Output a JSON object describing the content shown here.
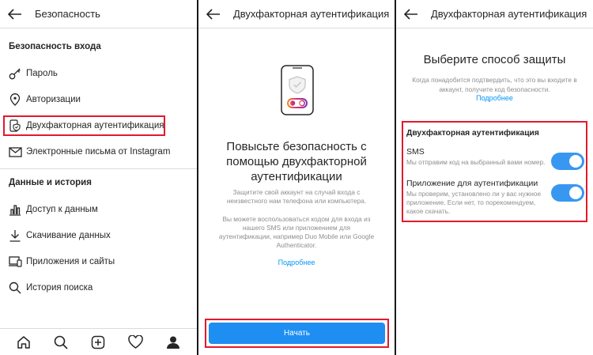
{
  "panel1": {
    "title": "Безопасность",
    "login_section": "Безопасность входа",
    "login_items": [
      {
        "label": "Пароль",
        "icon": "key-icon"
      },
      {
        "label": "Авторизации",
        "icon": "location-pin-icon"
      },
      {
        "label": "Двухфакторная аутентификация",
        "icon": "phone-shield-icon"
      },
      {
        "label": "Электронные письма от Instagram",
        "icon": "mail-icon"
      }
    ],
    "data_section": "Данные и история",
    "data_items": [
      {
        "label": "Доступ к данным",
        "icon": "bar-chart-icon"
      },
      {
        "label": "Скачивание данных",
        "icon": "download-icon"
      },
      {
        "label": "Приложения и сайты",
        "icon": "devices-icon"
      },
      {
        "label": "История поиска",
        "icon": "search-icon"
      }
    ],
    "nav": [
      "home-icon",
      "search-icon",
      "add-icon",
      "heart-icon",
      "profile-icon"
    ]
  },
  "panel2": {
    "title": "Двухфакторная аутентификация",
    "heading": "Повысьте безопасность с помощью двухфакторной аутентификации",
    "desc1": "Защитите свой аккаунт на случай входа с неизвестного нам телефона или компьютера.",
    "desc2": "Вы можете воспользоваться кодом для входа из нашего SMS или приложением для аутентификации, например Duo Mobile или Google Authenticator.",
    "more": "Подробнее",
    "start": "Начать"
  },
  "panel3": {
    "title": "Двухфакторная аутентификация",
    "heading": "Выберите способ защиты",
    "desc": "Когда понадобится подтвердить, что это вы входите в аккаунт, получите код безопасности.",
    "more": "Подробнее",
    "options_title": "Двухфакторная аутентификация",
    "options": [
      {
        "name": "SMS",
        "sub": "Мы отправим код на выбранный вами номер.",
        "enabled": true
      },
      {
        "name": "Приложение для аутентификации",
        "sub": "Мы проверим, установлено ли у вас нужное приложение. Если нет, то порекомендуем, какое скачать.",
        "enabled": true
      }
    ]
  },
  "colors": {
    "accent": "#1e8ef2",
    "highlight": "#e3192c",
    "toggle": "#3897f0"
  }
}
